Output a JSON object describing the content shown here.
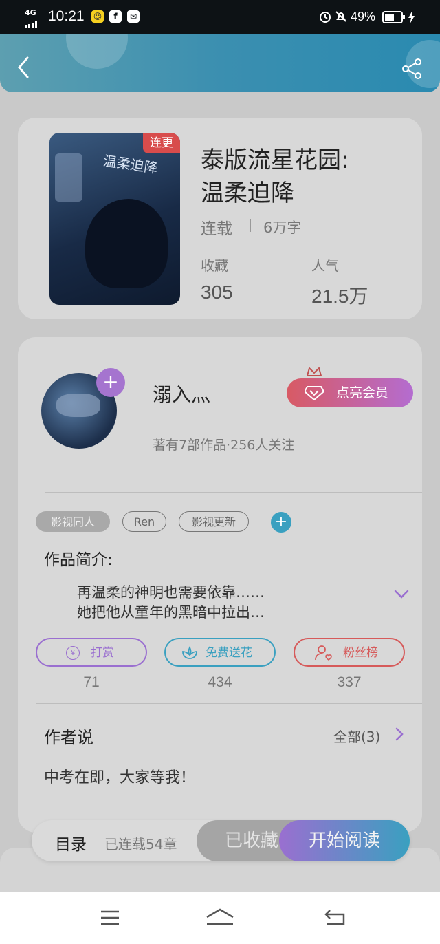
{
  "status_bar": {
    "signal": "4G",
    "time": "10:21",
    "battery": "49%"
  },
  "book": {
    "cover_badge": "连更",
    "cover_title": "温柔迫降",
    "title_line1": "泰版流星花园:",
    "title_line2": "温柔迫降",
    "status": "连载",
    "word_count": "6万字",
    "collect_label": "收藏",
    "collect_value": "305",
    "popularity_label": "人气",
    "popularity_value": "21.5万"
  },
  "author": {
    "name": "溺入灬",
    "stats": "著有7部作品·256人关注",
    "member_button": "点亮会员"
  },
  "tags": [
    "影视同人",
    "Ren",
    "影视更新"
  ],
  "intro": {
    "heading": "作品简介:",
    "line1": "再温柔的神明也需要依靠……",
    "line2": "她把他从童年的黑暗中拉出…"
  },
  "actions": [
    {
      "label": "打赏",
      "count": "71"
    },
    {
      "label": "免费送花",
      "count": "434"
    },
    {
      "label": "粉丝榜",
      "count": "337"
    }
  ],
  "author_says": {
    "heading": "作者说",
    "all_label": "全部(3)",
    "message": "中考在即，大家等我！"
  },
  "bottom_bar": {
    "toc": "目录",
    "chapters": "已连载54章",
    "collected": "已收藏",
    "start_read": "开始阅读"
  },
  "colors": {
    "accent_purple": "#9a6fd0",
    "accent_teal": "#3aa0c0",
    "accent_red": "#d65a5a",
    "header_blue": "#3b8fb0"
  }
}
